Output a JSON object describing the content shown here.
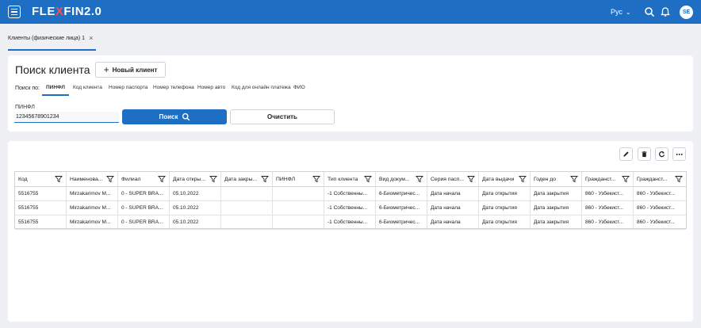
{
  "app": {
    "logo_left": "FLE",
    "logo_x": "X",
    "logo_right": "FIN2.0",
    "language": "Рус",
    "avatar_initials": "SE",
    "brand_color": "#1e6ec3"
  },
  "tabs": [
    {
      "label": "Клиенты (физические лица) 1"
    }
  ],
  "search": {
    "title": "Поиск клиента",
    "new_client_label": "Новый клиент",
    "search_by_label": "Поиск по:",
    "search_tabs": [
      {
        "label": "ПИНФЛ",
        "active": true
      },
      {
        "label": "Код клиента",
        "active": false
      },
      {
        "label": "Номер паспорта",
        "active": false
      },
      {
        "label": "Номер телефона",
        "active": false
      },
      {
        "label": "Номер авто",
        "active": false
      },
      {
        "label": "Код для онлайн платежа",
        "active": false
      },
      {
        "label": "ФИО",
        "active": false
      }
    ],
    "field_label": "ПИНФЛ",
    "field_value": "12345678901234",
    "search_button": "Поиск",
    "clear_button": "Очистить"
  },
  "table": {
    "columns": [
      "Код",
      "Наименова...",
      "Филиал",
      "Дата откры...",
      "Дата закры...",
      "ПИНФЛ",
      "Тип клиента",
      "Вид докум...",
      "Серия пасп...",
      "Дата выдачи",
      "Годен до",
      "Гражданст...",
      "Гражданст..."
    ],
    "rows": [
      [
        "5516755",
        "Mirzakarimov M...",
        "0 - SUPER BRA...",
        "05.10.2022",
        "",
        "",
        "-1 Собственны...",
        "6-Биометричес...",
        "Дата начала",
        "Дата открытия",
        "Дата закрытия",
        "860 - Узбекист...",
        "860 - Узбекист..."
      ],
      [
        "5516755",
        "Mirzakarimov M...",
        "0 - SUPER BRA...",
        "05.10.2022",
        "",
        "",
        "-1 Собственны...",
        "6-Биометричес...",
        "Дата начала",
        "Дата открытия",
        "Дата закрытия",
        "860 - Узбекист...",
        "860 - Узбекист..."
      ],
      [
        "5516755",
        "Mirzakarimov M...",
        "0 - SUPER BRA...",
        "05.10.2022",
        "",
        "",
        "-1 Собственны...",
        "6-Биометричес...",
        "Дата начала",
        "Дата открытия",
        "Дата закрытия",
        "860 - Узбекист...",
        "860 - Узбекист..."
      ]
    ]
  }
}
